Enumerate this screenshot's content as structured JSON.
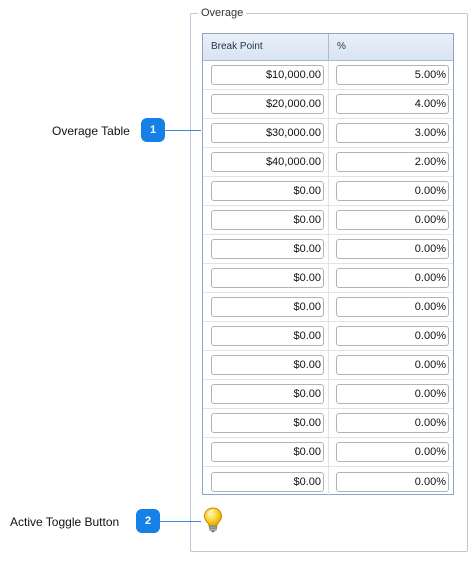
{
  "group": {
    "title": "Overage"
  },
  "table": {
    "headers": [
      "Break Point",
      "%"
    ],
    "rows": [
      {
        "break_point": "$10,000.00",
        "percent": "5.00%"
      },
      {
        "break_point": "$20,000.00",
        "percent": "4.00%"
      },
      {
        "break_point": "$30,000.00",
        "percent": "3.00%"
      },
      {
        "break_point": "$40,000.00",
        "percent": "2.00%"
      },
      {
        "break_point": "$0.00",
        "percent": "0.00%"
      },
      {
        "break_point": "$0.00",
        "percent": "0.00%"
      },
      {
        "break_point": "$0.00",
        "percent": "0.00%"
      },
      {
        "break_point": "$0.00",
        "percent": "0.00%"
      },
      {
        "break_point": "$0.00",
        "percent": "0.00%"
      },
      {
        "break_point": "$0.00",
        "percent": "0.00%"
      },
      {
        "break_point": "$0.00",
        "percent": "0.00%"
      },
      {
        "break_point": "$0.00",
        "percent": "0.00%"
      },
      {
        "break_point": "$0.00",
        "percent": "0.00%"
      },
      {
        "break_point": "$0.00",
        "percent": "0.00%"
      },
      {
        "break_point": "$0.00",
        "percent": "0.00%"
      }
    ]
  },
  "callouts": [
    {
      "number": "1",
      "label": "Overage Table"
    },
    {
      "number": "2",
      "label": "Active Toggle Button"
    }
  ],
  "toggle": {
    "icon": "lightbulb-icon"
  },
  "colors": {
    "badge": "#1580e6",
    "header_bg": "#dfe8f3",
    "bulb": "#f5c518"
  }
}
